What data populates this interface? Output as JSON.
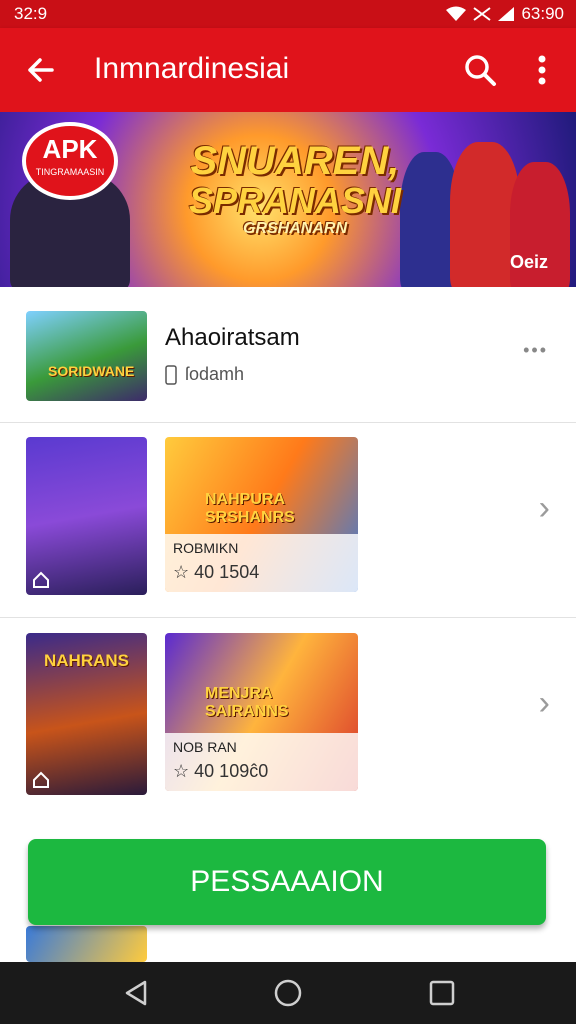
{
  "status": {
    "time": "32:9",
    "clock_right": "63:90"
  },
  "appbar": {
    "title": "Inmnardinesiai"
  },
  "banner": {
    "badge_main": "APK",
    "badge_sub": "TINGRAMAASIN",
    "headline_1": "SNUAREN,",
    "headline_2": "SPRANASNI",
    "headline_3": "GRSHANARN",
    "corner_tag": "Oeiz"
  },
  "featured": {
    "name": "Ahaoiratsam",
    "sub_icon": "phone-icon",
    "sub_text": "ſodamh",
    "thumb_tag": "SORIDWANE",
    "more": "•••"
  },
  "rows": [
    {
      "card_title": "NAHPURA SRSHANRS",
      "card_label": "ROBMIKN",
      "card_value": "40 1504"
    },
    {
      "left_tag": "NAHRANS",
      "card_title": "MENJRA SAIRANNS",
      "card_label": "NOB RAN",
      "card_value": "40 109ĉ0"
    }
  ],
  "cta": {
    "label": "PESSAAAION"
  },
  "colors": {
    "appbar": "#e0131b",
    "cta": "#1cb840",
    "navbar": "#1a1a1a"
  }
}
